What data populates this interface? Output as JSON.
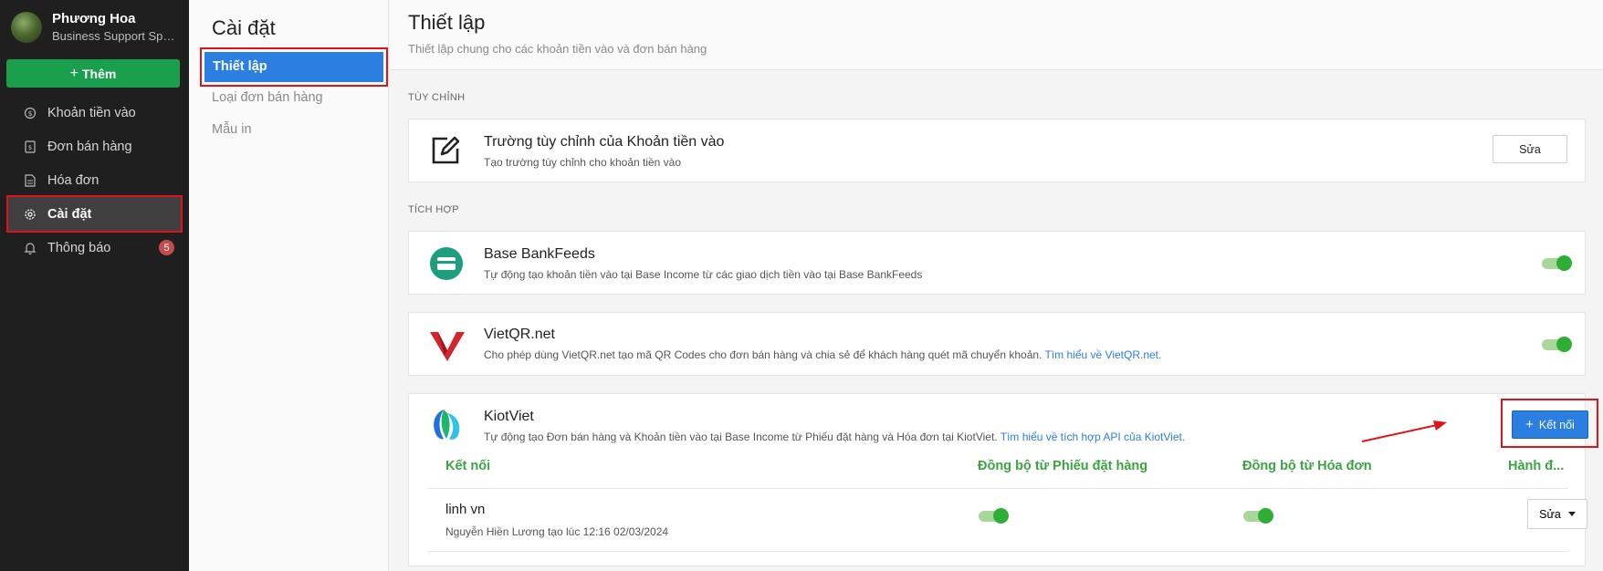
{
  "user": {
    "name": "Phương Hoa",
    "role": "Business Support Specialist"
  },
  "sidebar": {
    "add_label": "Thêm",
    "items": [
      {
        "label": "Khoản tiền vào",
        "icon": "money-in-icon"
      },
      {
        "label": "Đơn bán hàng",
        "icon": "order-icon"
      },
      {
        "label": "Hóa đơn",
        "icon": "invoice-icon"
      },
      {
        "label": "Cài đặt",
        "icon": "gear-icon",
        "active": true
      },
      {
        "label": "Thông báo",
        "icon": "bell-icon",
        "badge": "5"
      }
    ]
  },
  "submenu": {
    "title": "Cài đặt",
    "items": [
      {
        "label": "Thiết lập",
        "active": true
      },
      {
        "label": "Loại đơn bán hàng"
      },
      {
        "label": "Mẫu in"
      }
    ]
  },
  "main": {
    "title": "Thiết lập",
    "subtitle": "Thiết lập chung cho các khoản tiền vào và đơn bán hàng",
    "sections": {
      "custom": "TÙY CHỈNH",
      "integration": "TÍCH HỢP"
    },
    "custom_field": {
      "title": "Trường tùy chỉnh của Khoản tiền vào",
      "desc": "Tạo trường tùy chỉnh cho khoản tiền vào",
      "edit_label": "Sửa"
    },
    "bankfeeds": {
      "title": "Base BankFeeds",
      "desc": "Tự động tạo khoản tiền vào tại Base Income từ các giao dịch tiền vào tại Base BankFeeds",
      "enabled": true
    },
    "vietqr": {
      "title": "VietQR.net",
      "desc": "Cho phép dùng VietQR.net tạo mã QR Codes cho đơn bán hàng và chia sẻ để khách hàng quét mã chuyển khoản.",
      "link": "Tìm hiểu về VietQR.net.",
      "enabled": true
    },
    "kiotviet": {
      "title": "KiotViet",
      "desc": "Tự động tạo Đơn bán hàng và Khoản tiền vào tại Base Income từ Phiếu đặt hàng và Hóa đơn tại KiotViet.",
      "link": "Tìm hiểu về tích hợp API của KiotViet.",
      "connect_label": "Kết nối",
      "columns": [
        "Kết nối",
        "Đồng bộ từ Phiếu đặt hàng",
        "Đồng bộ từ Hóa đơn",
        "Hành đ..."
      ],
      "rows": [
        {
          "name": "linh vn",
          "meta": "Nguyễn Hiền Lương tạo lúc 12:16 02/03/2024",
          "sync_orders": true,
          "sync_invoices": true,
          "action_label": "Sửa"
        }
      ]
    }
  },
  "colors": {
    "accent": "#2a7fe0",
    "success": "#1aa04d",
    "highlight": "#e0131a",
    "sidebar_bg": "#1f1f1f"
  }
}
